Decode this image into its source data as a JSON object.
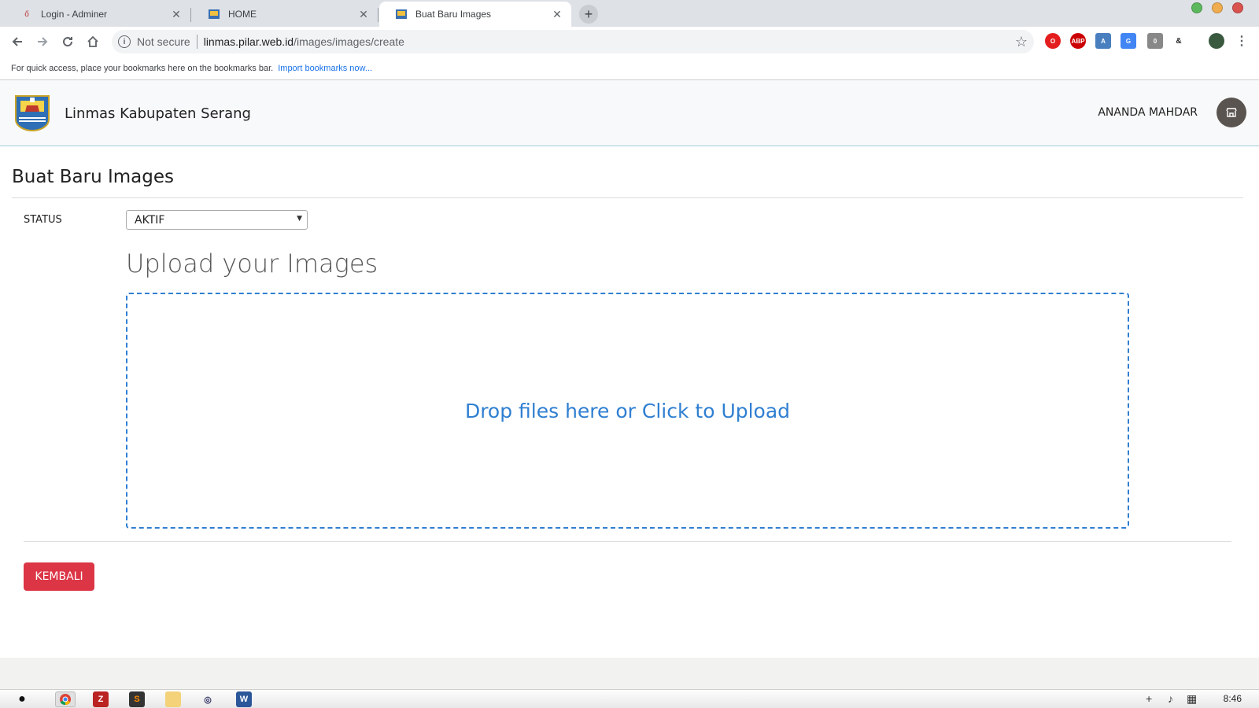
{
  "browser": {
    "tabs": [
      {
        "label": "Login - Adminer",
        "active": false
      },
      {
        "label": "HOME",
        "active": false
      },
      {
        "label": "Buat Baru Images",
        "active": true
      }
    ],
    "security_label": "Not secure",
    "url_host": "linmas.pilar.web.id",
    "url_path": "/images/images/create",
    "bookmarks_text": "For quick access, place your bookmarks here on the bookmarks bar.",
    "bookmarks_link": "Import bookmarks now..."
  },
  "header": {
    "brand": "Linmas Kabupaten Serang",
    "user": "ANANDA MAHDAR"
  },
  "form": {
    "title": "Buat Baru Images",
    "status_label": "STATUS",
    "status_value": "AKTIF",
    "upload_title": "Upload your Images",
    "dropzone_text": "Drop files here or Click to Upload",
    "back_button": "KEMBALI"
  },
  "taskbar": {
    "clock": "8:46"
  },
  "colors": {
    "accent_blue": "#2f7fd1",
    "danger_red": "#dc3545",
    "header_bg": "#f8f9fa"
  }
}
